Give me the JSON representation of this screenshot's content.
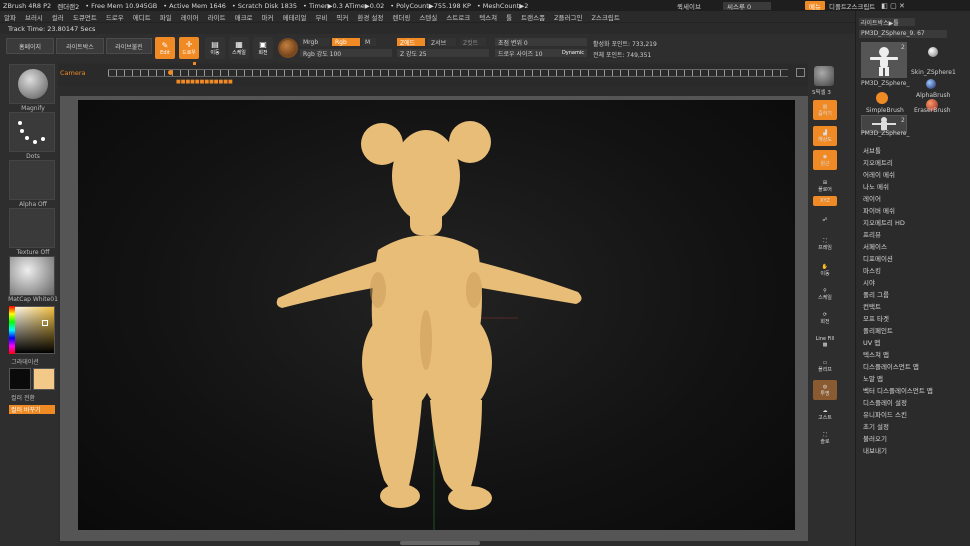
{
  "titlebar": {
    "app": "ZBrush 4R8 P2",
    "doc": "렌더랜2",
    "free_mem": "• Free Mem 10.945GB",
    "active_mem": "• Active Mem 1646",
    "scratch": "• Scratch Disk 1835",
    "timer": "• Timer▶0.3 ATime▶0.02",
    "polycount": "• PolyCount▶755.198 KP",
    "meshcount": "• MeshCount▶2"
  },
  "topright": {
    "quicksave": "퀵세이브",
    "see_through": "씨스루 0",
    "menu": "메뉴",
    "default_script": "디폴트Z스크립트"
  },
  "menu": [
    "알파",
    "브러시",
    "컬러",
    "도큐먼트",
    "드로우",
    "에디트",
    "파일",
    "레이어",
    "라이트",
    "매크로",
    "마커",
    "메테리얼",
    "무비",
    "픽커",
    "환경 설정",
    "렌더링",
    "스텐실",
    "스트로크",
    "텍스쳐",
    "툴",
    "트랜스폼",
    "Z플러그인",
    "Z스크립트"
  ],
  "track": {
    "label": "Track Time: 23.80147 Secs"
  },
  "toolbar": {
    "home": "홈페이지",
    "lightbox": "라이트박스",
    "lightbox_live": "라이브불린",
    "edit": "Edit",
    "draw": "드로우",
    "move": "이동",
    "scale": "스케일",
    "rotate": "회전",
    "mrgb": "Mrgb",
    "rgb": "Rgb",
    "m": "M",
    "rgb_intensity": "Rgb 강도 100",
    "zadd": "Z에드",
    "zsub": "Z서브",
    "zcut": "Z컷트",
    "z_intensity": "Z 강도 25",
    "focal": "초점 변위 0",
    "draw_size": "드로우 사이즈 10",
    "dynamic": "Dynamic",
    "active_points": "활성화 포인트: 733,219",
    "total_points": "전체 포인트: 749,351"
  },
  "timeline": {
    "camera": "Camera",
    "marker": "■■■■■■■■■■■■"
  },
  "leftpanel": {
    "brush": "Magnify",
    "stroke": "Dots",
    "alpha": "Alpha Off",
    "texture": "Texture Off",
    "material": "MatCap White01",
    "gradient": "그라데이션",
    "swap": "컬러 전환",
    "fill": "컬러 바꾸기"
  },
  "rightcol": {
    "spix": "S픽셀 3",
    "items": [
      "줌하기",
      "해상도",
      "원근",
      "플로어",
      "로컬",
      "XYZ",
      "프레임",
      "이동",
      "스케일",
      "회전",
      "Line Fill",
      "폴리프",
      "투명",
      "고스트",
      "솔로"
    ]
  },
  "palette": {
    "header": "라이트박스▶툴",
    "tool_name": "PM3D_ZSphere_9. 67",
    "thumbs": [
      "PM3D_ZSphere_",
      "Skin_ZSphere1",
      "SimpleBrush",
      "EraserBrush",
      "AlphaBrush",
      "PM3D_ZSphere_"
    ],
    "counts": [
      "2",
      "2"
    ],
    "items": [
      "서브툴",
      "지오메트리",
      "어레이 메쉬",
      "나노 메쉬",
      "레이어",
      "파이버 메쉬",
      "지오메트리 HD",
      "프리뷰",
      "서페이스",
      "디포메이션",
      "마스킹",
      "시야",
      "폴리 그룹",
      "컨택트",
      "모프 타겟",
      "폴리페인트",
      "UV 맵",
      "텍스쳐 맵",
      "디스플레이스먼트 맵",
      "노말 맵",
      "벡터 디스플레이스먼트 맵",
      "디스플레이 설정",
      "유니파이드 스킨",
      "초기 설정",
      "불러오기",
      "내보내기"
    ]
  },
  "colors": {
    "accent": "#f08a24",
    "primary_color": "#0a0a0a",
    "secondary_color": "#f2c989",
    "model": "#e8bd78"
  }
}
